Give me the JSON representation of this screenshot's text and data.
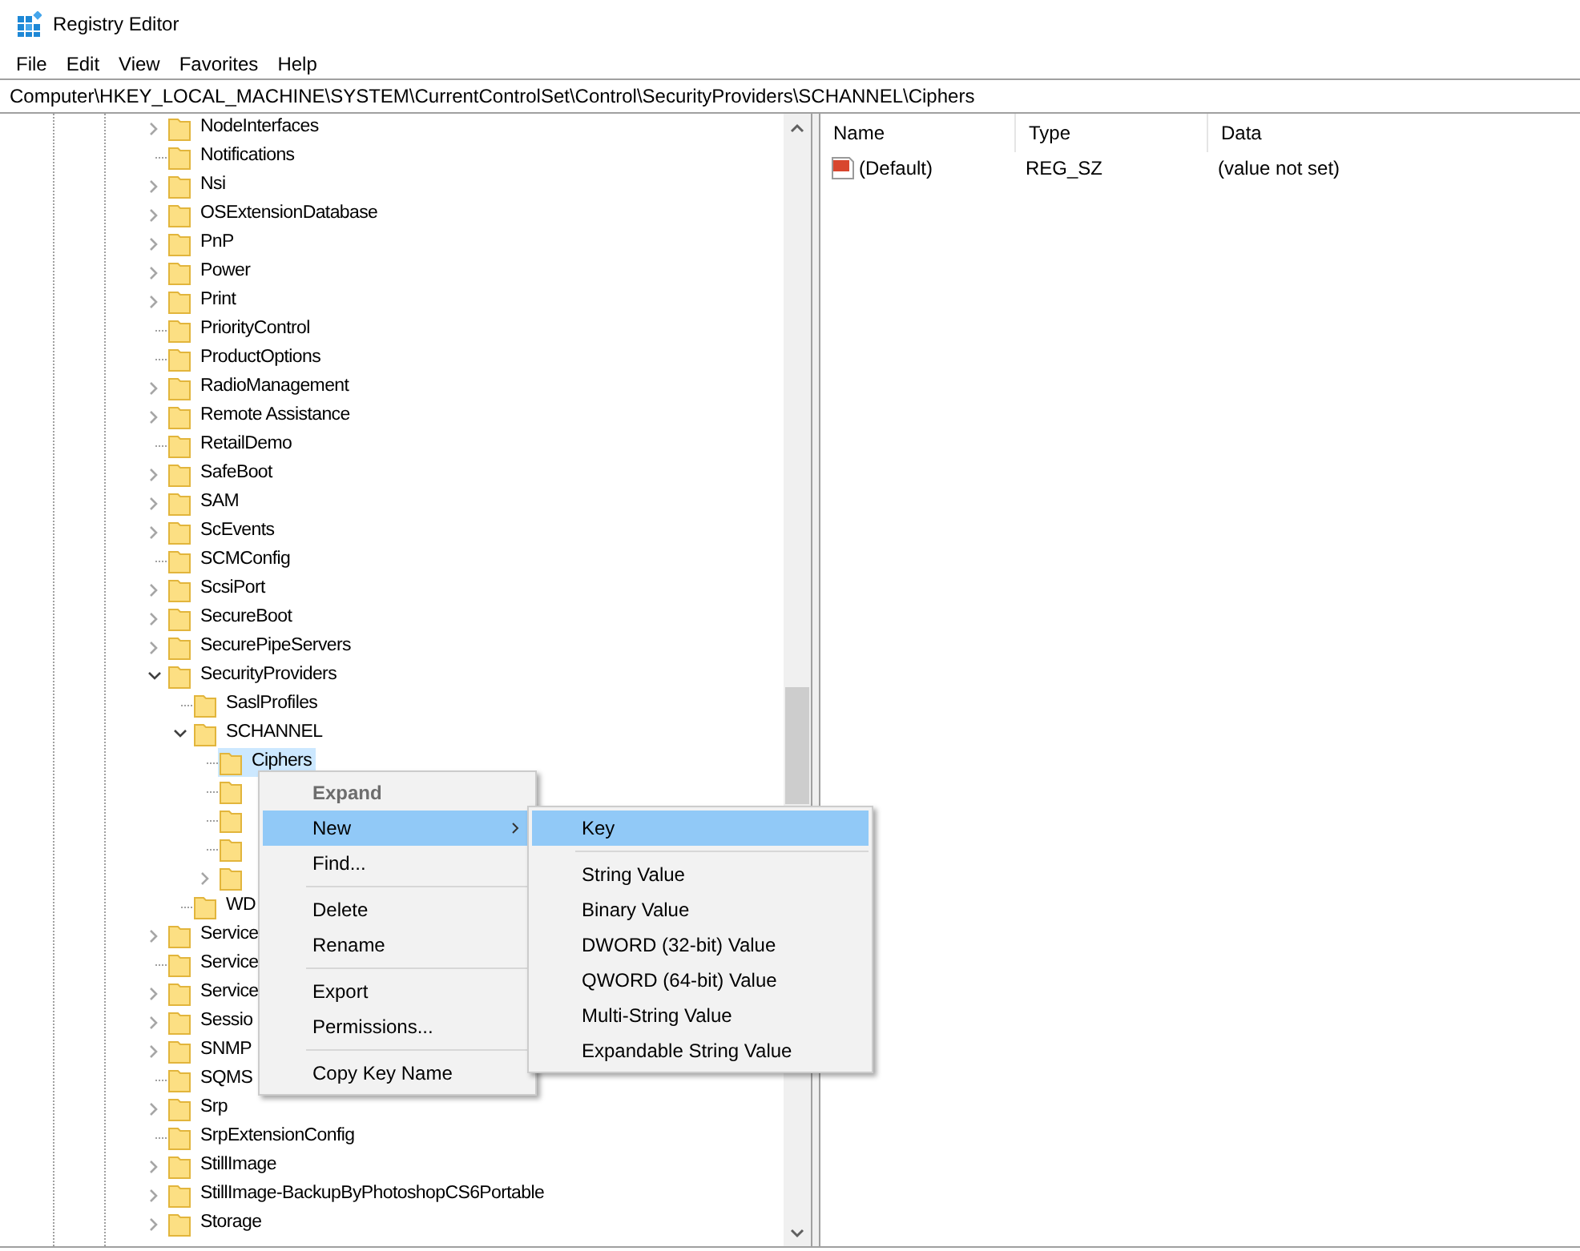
{
  "window": {
    "title": "Registry Editor"
  },
  "menu_bar": [
    "File",
    "Edit",
    "View",
    "Favorites",
    "Help"
  ],
  "address_bar": {
    "value": "Computer\\HKEY_LOCAL_MACHINE\\SYSTEM\\CurrentControlSet\\Control\\SecurityProviders\\SCHANNEL\\Ciphers"
  },
  "tree": {
    "items": [
      {
        "label": "NodeInterfaces",
        "has_children": true,
        "expanded": false,
        "selected": false
      },
      {
        "label": "Notifications",
        "has_children": false,
        "selected": false
      },
      {
        "label": "Nsi",
        "has_children": true,
        "expanded": false,
        "selected": false
      },
      {
        "label": "OSExtensionDatabase",
        "has_children": true,
        "expanded": false,
        "selected": false
      },
      {
        "label": "PnP",
        "has_children": true,
        "expanded": false,
        "selected": false
      },
      {
        "label": "Power",
        "has_children": true,
        "expanded": false,
        "selected": false
      },
      {
        "label": "Print",
        "has_children": true,
        "expanded": false,
        "selected": false
      },
      {
        "label": "PriorityControl",
        "has_children": false,
        "selected": false
      },
      {
        "label": "ProductOptions",
        "has_children": false,
        "selected": false
      },
      {
        "label": "RadioManagement",
        "has_children": true,
        "expanded": false,
        "selected": false
      },
      {
        "label": "Remote Assistance",
        "has_children": true,
        "expanded": false,
        "selected": false
      },
      {
        "label": "RetailDemo",
        "has_children": false,
        "selected": false
      },
      {
        "label": "SafeBoot",
        "has_children": true,
        "expanded": false,
        "selected": false
      },
      {
        "label": "SAM",
        "has_children": true,
        "expanded": false,
        "selected": false
      },
      {
        "label": "ScEvents",
        "has_children": true,
        "expanded": false,
        "selected": false
      },
      {
        "label": "SCMConfig",
        "has_children": false,
        "selected": false
      },
      {
        "label": "ScsiPort",
        "has_children": true,
        "expanded": false,
        "selected": false
      },
      {
        "label": "SecureBoot",
        "has_children": true,
        "expanded": false,
        "selected": false
      },
      {
        "label": "SecurePipeServers",
        "has_children": true,
        "expanded": false,
        "selected": false
      },
      {
        "label": "SecurityProviders",
        "has_children": true,
        "expanded": true,
        "selected": false,
        "children": [
          {
            "label": "SaslProfiles",
            "has_children": false,
            "selected": false
          },
          {
            "label": "SCHANNEL",
            "has_children": true,
            "expanded": true,
            "selected": false,
            "children": [
              {
                "label": "Ciphers",
                "has_children": false,
                "selected": true
              },
              {
                "has_children": false,
                "selected": false
              },
              {
                "has_children": false,
                "selected": false
              },
              {
                "has_children": false,
                "selected": false
              },
              {
                "has_children": true,
                "expanded": false,
                "selected": false
              }
            ]
          },
          {
            "label": "WD",
            "has_children": false,
            "selected": false
          }
        ]
      },
      {
        "label": "Service",
        "has_children": true,
        "expanded": false,
        "selected": false
      },
      {
        "label": "Service",
        "has_children": false,
        "selected": false
      },
      {
        "label": "Service",
        "has_children": true,
        "expanded": false,
        "selected": false
      },
      {
        "label": "Sessio",
        "has_children": true,
        "expanded": false,
        "selected": false
      },
      {
        "label": "SNMP",
        "has_children": true,
        "expanded": false,
        "selected": false
      },
      {
        "label": "SQMS",
        "has_children": false,
        "selected": false
      },
      {
        "label": "Srp",
        "has_children": true,
        "expanded": false,
        "selected": false
      },
      {
        "label": "SrpExtensionConfig",
        "has_children": false,
        "selected": false
      },
      {
        "label": "StillImage",
        "has_children": true,
        "expanded": false,
        "selected": false
      },
      {
        "label": "StillImage-BackupByPhotoshopCS6Portable",
        "has_children": true,
        "expanded": false,
        "selected": false
      },
      {
        "label": "Storage",
        "has_children": true,
        "expanded": false,
        "selected": false
      }
    ]
  },
  "values_list": {
    "columns": [
      "Name",
      "Type",
      "Data"
    ],
    "rows": [
      {
        "name": "(Default)",
        "type": "REG_SZ",
        "data": "(value not set)"
      }
    ]
  },
  "context_menu": {
    "items": [
      {
        "kind": "item",
        "label": "Expand",
        "default": true,
        "disabled": true,
        "selected": false
      },
      {
        "kind": "item",
        "label": "New",
        "submenu": true,
        "selected": true
      },
      {
        "kind": "item",
        "label": "Find...",
        "selected": false
      },
      {
        "kind": "separator"
      },
      {
        "kind": "item",
        "label": "Delete",
        "selected": false
      },
      {
        "kind": "item",
        "label": "Rename",
        "selected": false
      },
      {
        "kind": "separator"
      },
      {
        "kind": "item",
        "label": "Export",
        "selected": false
      },
      {
        "kind": "item",
        "label": "Permissions...",
        "selected": false
      },
      {
        "kind": "separator"
      },
      {
        "kind": "item",
        "label": "Copy Key Name",
        "selected": false
      }
    ]
  },
  "submenu": {
    "items": [
      {
        "kind": "item",
        "label": "Key",
        "selected": true
      },
      {
        "kind": "separator"
      },
      {
        "kind": "item",
        "label": "String Value",
        "selected": false
      },
      {
        "kind": "item",
        "label": "Binary Value",
        "selected": false
      },
      {
        "kind": "item",
        "label": "DWORD (32-bit) Value",
        "selected": false
      },
      {
        "kind": "item",
        "label": "QWORD (64-bit) Value",
        "selected": false
      },
      {
        "kind": "item",
        "label": "Multi-String Value",
        "selected": false
      },
      {
        "kind": "item",
        "label": "Expandable String Value",
        "selected": false
      }
    ]
  }
}
